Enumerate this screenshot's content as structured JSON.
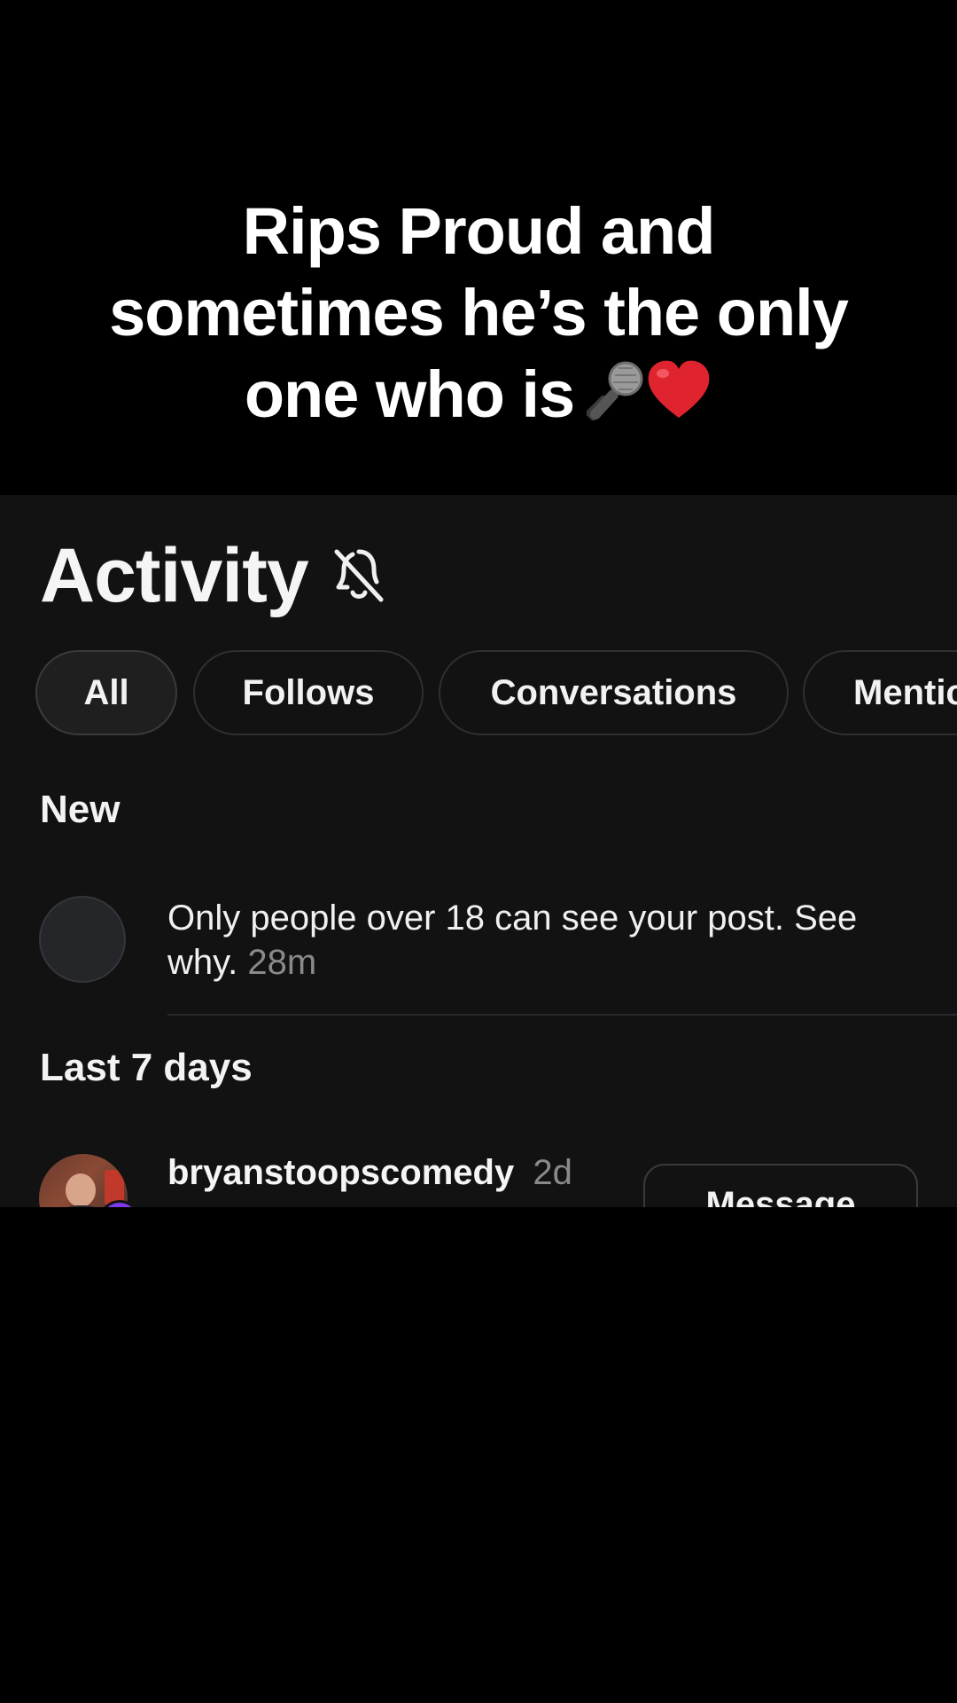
{
  "caption": {
    "line1": "Rips Proud and",
    "line2": "sometimes he’s the only",
    "line3": "one who is",
    "emoji_icons": [
      "microphone-icon",
      "red-heart-icon"
    ]
  },
  "activity": {
    "title": "Activity",
    "header_icon": "bell-off-icon"
  },
  "filters": [
    {
      "label": "All",
      "active": true
    },
    {
      "label": "Follows",
      "active": false
    },
    {
      "label": "Conversations",
      "active": false
    },
    {
      "label": "Mentic",
      "active": false
    }
  ],
  "sections": {
    "new_label": "New",
    "last7_label": "Last 7 days"
  },
  "notifications": {
    "age_notice": {
      "text": "Only people over 18 can see your post. See why.",
      "time": "28m"
    },
    "follow_item": {
      "username": "bryanstoopscomedy",
      "time": "2d",
      "action_label": "Message"
    }
  },
  "colors": {
    "background": "#000000",
    "panel": "#121213",
    "muted_text": "#8a8a8d",
    "chip_border": "#2f2f31",
    "heart": "#e0242f"
  }
}
